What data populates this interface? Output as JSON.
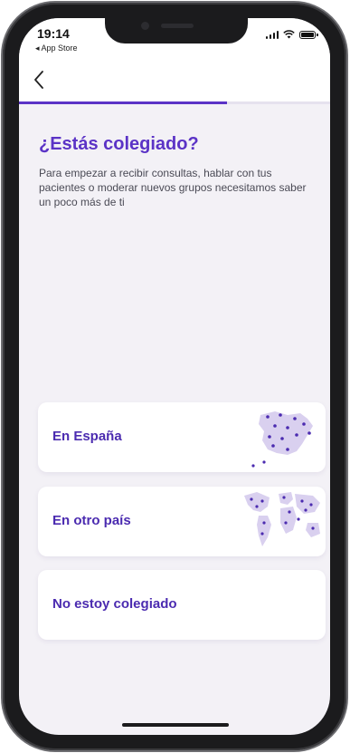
{
  "status_bar": {
    "time": "19:14",
    "back_to_app": "◂ App Store"
  },
  "nav": {
    "back_icon": "chevron-left-icon",
    "progress": 0.67
  },
  "main": {
    "title": "¿Estás colegiado?",
    "subtitle": "Para empezar a recibir consultas, hablar con tus pacientes o moderar nuevos grupos necesitamos saber un poco más de ti"
  },
  "options": [
    {
      "label": "En España",
      "icon": "spain-map-icon"
    },
    {
      "label": "En otro país",
      "icon": "world-map-icon"
    },
    {
      "label": "No estoy colegiado",
      "icon": ""
    }
  ],
  "colors": {
    "accent": "#5b33c6",
    "card_text": "#4b2bb0",
    "background": "#f3f1f6",
    "map_fill": "#d9d0ef",
    "map_dot": "#4b2bb0"
  }
}
